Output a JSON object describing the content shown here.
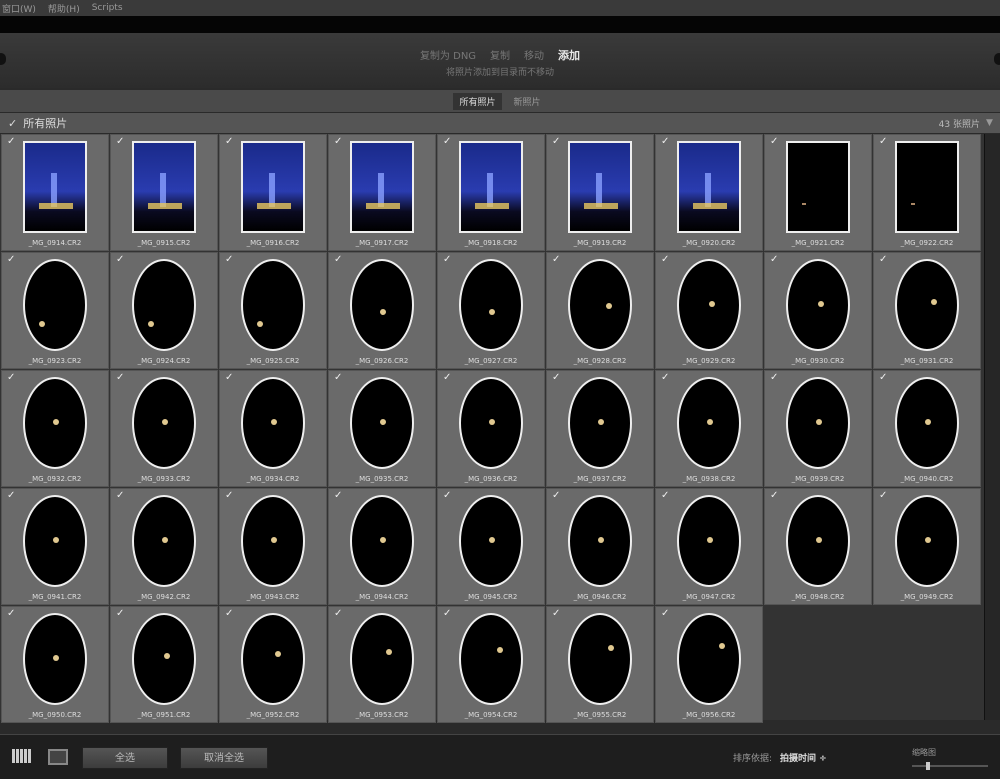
{
  "menu": [
    "窗口(W)",
    "帮助(H)",
    "Scripts"
  ],
  "header": {
    "modes": [
      "复制为 DNG",
      "复制",
      "移动",
      "添加"
    ],
    "active_mode": "添加",
    "subtitle": "将照片添加到目录而不移动"
  },
  "tabs": [
    "所有照片",
    "新照片"
  ],
  "section": {
    "title": "所有照片",
    "count": "43 张照片"
  },
  "photos": [
    {
      "name": "_MG_0914.CR2",
      "type": "city"
    },
    {
      "name": "_MG_0915.CR2",
      "type": "city"
    },
    {
      "name": "_MG_0916.CR2",
      "type": "city"
    },
    {
      "name": "_MG_0917.CR2",
      "type": "city"
    },
    {
      "name": "_MG_0918.CR2",
      "type": "city"
    },
    {
      "name": "_MG_0919.CR2",
      "type": "city"
    },
    {
      "name": "_MG_0920.CR2",
      "type": "city"
    },
    {
      "name": "_MG_0921.CR2",
      "type": "lights"
    },
    {
      "name": "_MG_0922.CR2",
      "type": "lights"
    },
    {
      "name": "_MG_0923.CR2",
      "type": "moon"
    },
    {
      "name": "_MG_0924.CR2",
      "type": "moon"
    },
    {
      "name": "_MG_0925.CR2",
      "type": "moon"
    },
    {
      "name": "_MG_0926.CR2",
      "type": "moon"
    },
    {
      "name": "_MG_0927.CR2",
      "type": "moon"
    },
    {
      "name": "_MG_0928.CR2",
      "type": "moon"
    },
    {
      "name": "_MG_0929.CR2",
      "type": "moon"
    },
    {
      "name": "_MG_0930.CR2",
      "type": "moon"
    },
    {
      "name": "_MG_0931.CR2",
      "type": "moon"
    },
    {
      "name": "_MG_0932.CR2",
      "type": "moon"
    },
    {
      "name": "_MG_0933.CR2",
      "type": "moon"
    },
    {
      "name": "_MG_0934.CR2",
      "type": "moon"
    },
    {
      "name": "_MG_0935.CR2",
      "type": "moon"
    },
    {
      "name": "_MG_0936.CR2",
      "type": "moon"
    },
    {
      "name": "_MG_0937.CR2",
      "type": "moon"
    },
    {
      "name": "_MG_0938.CR2",
      "type": "moon"
    },
    {
      "name": "_MG_0939.CR2",
      "type": "moon"
    },
    {
      "name": "_MG_0940.CR2",
      "type": "moon"
    },
    {
      "name": "_MG_0941.CR2",
      "type": "moon"
    },
    {
      "name": "_MG_0942.CR2",
      "type": "moon"
    },
    {
      "name": "_MG_0943.CR2",
      "type": "moon"
    },
    {
      "name": "_MG_0944.CR2",
      "type": "moon"
    },
    {
      "name": "_MG_0945.CR2",
      "type": "moon"
    },
    {
      "name": "_MG_0946.CR2",
      "type": "moon"
    },
    {
      "name": "_MG_0947.CR2",
      "type": "moon"
    },
    {
      "name": "_MG_0948.CR2",
      "type": "moon"
    },
    {
      "name": "_MG_0949.CR2",
      "type": "moon"
    },
    {
      "name": "_MG_0950.CR2",
      "type": "moon"
    },
    {
      "name": "_MG_0951.CR2",
      "type": "moon"
    },
    {
      "name": "_MG_0952.CR2",
      "type": "moon"
    },
    {
      "name": "_MG_0953.CR2",
      "type": "moon"
    },
    {
      "name": "_MG_0954.CR2",
      "type": "moon"
    },
    {
      "name": "_MG_0955.CR2",
      "type": "moon"
    },
    {
      "name": "_MG_0956.CR2",
      "type": "moon"
    }
  ],
  "bottom": {
    "select_all": "全选",
    "deselect_all": "取消全选",
    "sort_label": "排序依据:",
    "sort_value": "拍摄时间 ÷",
    "thumb_label": "缩略图"
  },
  "checked_mark": "✓"
}
